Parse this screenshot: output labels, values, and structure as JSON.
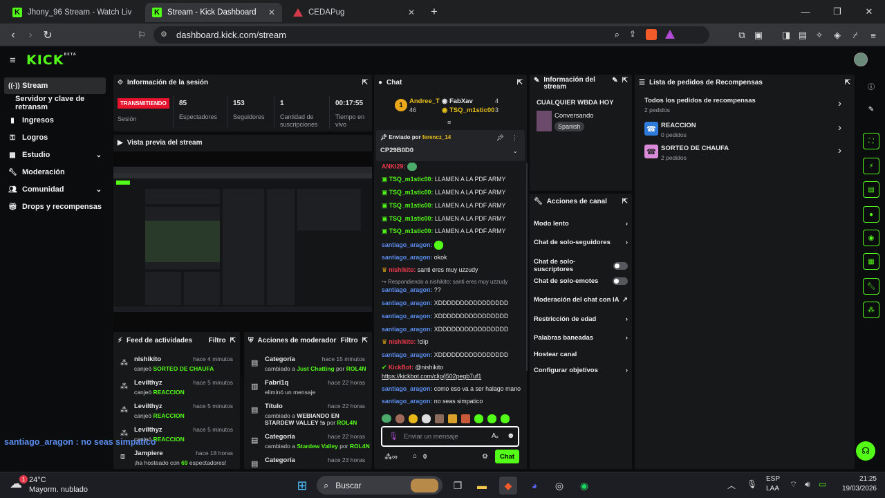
{
  "browser": {
    "tabs": [
      {
        "label": "Jhony_96 Stream - Watch Live on Kick"
      },
      {
        "label": "Stream - Kick Dashboard"
      },
      {
        "label": "CEDAPug"
      }
    ],
    "url": "dashboard.kick.com/stream"
  },
  "brand": {
    "logo": "KICK",
    "beta": "BETA",
    "accent": "#53fc18"
  },
  "sidebar": {
    "items": [
      {
        "label": "Stream",
        "icon": "broadcast-icon"
      },
      {
        "label": "Servidor y clave de retransm"
      },
      {
        "label": "Ingresos",
        "icon": "chart-icon"
      },
      {
        "label": "Logros",
        "icon": "key-icon"
      },
      {
        "label": "Estudio",
        "icon": "grid-icon"
      },
      {
        "label": "Moderación",
        "icon": "wrench-icon"
      },
      {
        "label": "Comunidad",
        "icon": "people-icon"
      },
      {
        "label": "Drops y recompensas",
        "icon": "gift-icon"
      }
    ]
  },
  "session": {
    "title": "Información de la sesión",
    "status": "TRANSMITIENDO",
    "status_label": "Sesión",
    "viewers": "85",
    "viewers_label": "Espectadores",
    "followers": "153",
    "followers_label": "Seguidores",
    "subs": "1",
    "subs_label": "Cantidad de suscripciones",
    "uptime": "00:17:55",
    "uptime_label": "Tiempo en vivo"
  },
  "preview": {
    "title": "Vista previa del stream",
    "overlay": "santiago_aragon : no seas simpatico"
  },
  "activity": {
    "title": "Feed de actividades",
    "filter": "Filtro",
    "items": [
      {
        "user": "nishikito",
        "action": "canjeó",
        "item": "SORTEO DE CHAUFA",
        "time": "hace 4 minutos"
      },
      {
        "user": "Levilthyz",
        "action": "canjeó",
        "item": "REACCION",
        "time": "hace 5 minutos"
      },
      {
        "user": "Levilthyz",
        "action": "canjeó",
        "item": "REACCION",
        "time": "hace 5 minutos"
      },
      {
        "user": "Levilthyz",
        "action": "canjeó",
        "item": "REACCION",
        "time": "hace 5 minutos"
      },
      {
        "user": "Jampiere",
        "action": "¡ha hosteado con",
        "item": "69",
        "suffix": "espectadores!",
        "time": "hace 18 horas"
      }
    ]
  },
  "modactions": {
    "title": "Acciones de moderador",
    "filter": "Filtro",
    "items": [
      {
        "title": "Categoría",
        "time": "hace 15 minutos",
        "l1": "cambiado a",
        "h1": "Just Chatting",
        "l2": "por",
        "h2": "ROL4N"
      },
      {
        "title": "Fabri1q",
        "time": "hace 22 horas",
        "l1": "eliminó un mensaje"
      },
      {
        "title": "Título",
        "time": "hace 22 horas",
        "l1": "cambiado a",
        "h1": "WEBIANDO EN STARDEW VALLEY !s",
        "l2": "por",
        "h2": "ROL4N"
      },
      {
        "title": "Categoría",
        "time": "hace 22 horas",
        "l1": "cambiado a",
        "h1": "Stardew Valley",
        "l2": "por",
        "h2": "ROL4N"
      },
      {
        "title": "Categoría",
        "time": "hace 23 horas"
      }
    ]
  },
  "chat": {
    "title": "Chat",
    "leaders": [
      {
        "name": "Andree_T",
        "count": "46"
      },
      {
        "name": "FabXav",
        "count": "4"
      },
      {
        "name": "TSQ_m1stic00",
        "count": "3"
      }
    ],
    "rank": "1",
    "pinned": {
      "label": "Enviado por",
      "user": "ferencz_14",
      "text": "CP29B0D0"
    },
    "messages": [
      {
        "user": "ANKI29",
        "text": ""
      },
      {
        "user": "TSQ_m1stic00",
        "text": "LLAMEN A LA PDF ARMY"
      },
      {
        "user": "TSQ_m1stic00",
        "text": "LLAMEN A LA PDF ARMY"
      },
      {
        "user": "TSQ_m1stic00",
        "text": "LLAMEN A LA PDF ARMY"
      },
      {
        "user": "TSQ_m1stic00",
        "text": "LLAMEN A LA PDF ARMY"
      },
      {
        "user": "TSQ_m1stic00",
        "text": "LLAMEN A LA PDF ARMY"
      },
      {
        "user": "santiago_aragon",
        "text": ""
      },
      {
        "user": "santiago_aragon",
        "text": "okok"
      },
      {
        "user": "nishikito",
        "text": "santi eres muy uzzudy"
      },
      {
        "reply": "Respondiendo a nishikito: santi eres muy uzzudy"
      },
      {
        "user": "santiago_aragon",
        "text": "??"
      },
      {
        "user": "santiago_aragon",
        "text": "XDDDDDDDDDDDDDDDD"
      },
      {
        "user": "santiago_aragon",
        "text": "XDDDDDDDDDDDDDDDD"
      },
      {
        "user": "santiago_aragon",
        "text": "XDDDDDDDDDDDDDDDD"
      },
      {
        "user": "nishikito",
        "text": "!clip"
      },
      {
        "user": "santiago_aragon",
        "text": "XDDDDDDDDDDDDDDDD"
      },
      {
        "user": "KickBot",
        "text": "@nishikito",
        "link": "https://kickbot.com/clip/j502pegb7uf1"
      },
      {
        "user": "santiago_aragon",
        "text": "como eso va a ser halago mano"
      },
      {
        "user": "santiago_aragon",
        "text": "no seas simpatico"
      }
    ],
    "input_placeholder": "Enviar un mensaje",
    "points": "0",
    "send": "Chat"
  },
  "streaminfo": {
    "title": "Información del stream",
    "stream_title": "CUALQUIER WBDA HOY",
    "category": "Conversando",
    "language": "Spanish"
  },
  "channel": {
    "title": "Acciones de canal",
    "items": [
      {
        "label": "Modo lento",
        "type": "chevron"
      },
      {
        "label": "Chat de solo-seguidores",
        "type": "chevron"
      },
      {
        "label": "Chat de solo-suscriptores",
        "type": "toggle"
      },
      {
        "label": "Chat de solo-emotes",
        "type": "toggle"
      },
      {
        "label": "Moderación del chat con IA",
        "type": "external"
      },
      {
        "label": "Restricción de edad",
        "type": "chevron"
      },
      {
        "label": "Palabras baneadas",
        "type": "chevron"
      },
      {
        "label": "Hostear canal",
        "type": "none"
      },
      {
        "label": "Configurar objetivos",
        "type": "chevron"
      }
    ]
  },
  "rewards": {
    "title": "Lista de pedidos de Recompensas",
    "all_label": "Todos los pedidos de recompensas",
    "all_count": "2 pedidos",
    "items": [
      {
        "name": "REACCION",
        "count": "0 pedidos",
        "color": "#2e7bd9"
      },
      {
        "name": "SORTEO DE CHAUFA",
        "count": "2 pedidos",
        "color": "#d98ad9"
      }
    ]
  },
  "taskbar": {
    "weather_temp": "24°C",
    "weather_desc": "Mayorm. nublado",
    "badge": "1",
    "search": "Buscar",
    "lang1": "ESP",
    "lang2": "LAA",
    "time": "21:25",
    "date": "19/03/2026"
  }
}
